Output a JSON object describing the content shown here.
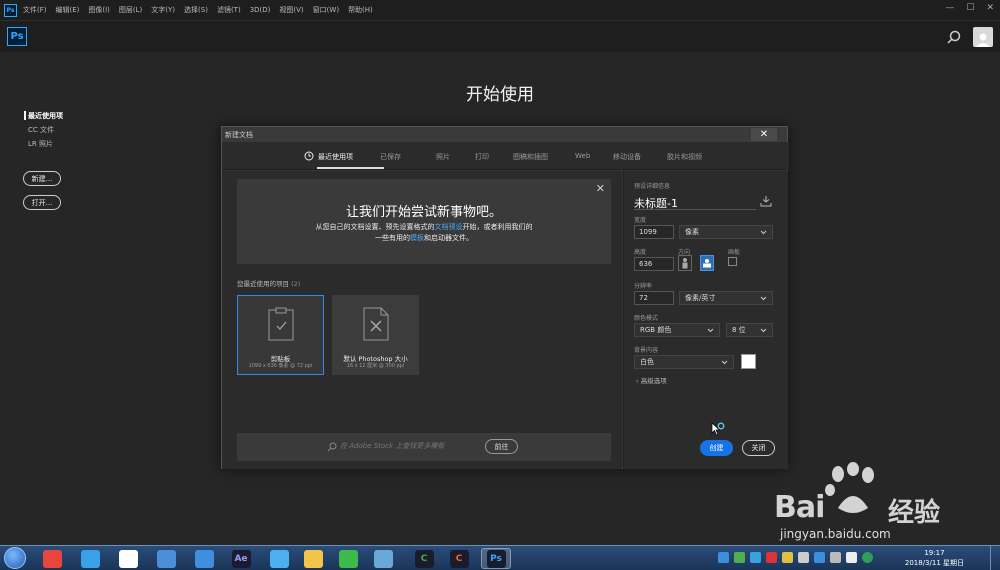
{
  "menubar": {
    "app_icon": "Ps",
    "items": [
      "文件(F)",
      "编辑(E)",
      "图像(I)",
      "图层(L)",
      "文字(Y)",
      "选择(S)",
      "滤镜(T)",
      "3D(D)",
      "视图(V)",
      "窗口(W)",
      "帮助(H)"
    ],
    "controls": [
      "—",
      "☐",
      "✕"
    ]
  },
  "appbar": {
    "logo": "Ps",
    "search_icon": "search-icon",
    "avatar_icon": "user-avatar-icon"
  },
  "start": {
    "title": "开始使用",
    "nav": [
      "最近使用项",
      "CC 文件",
      "LR 照片"
    ],
    "new_button": "新建...",
    "open_button": "打开..."
  },
  "dialog": {
    "title": "新建文档",
    "close": "✕",
    "tabs": [
      "最近使用项",
      "已保存",
      "照片",
      "打印",
      "图稿和插图",
      "Web",
      "移动设备",
      "胶片和视频"
    ],
    "active_tab": 0,
    "promo": {
      "title": "让我们开始尝试新事物吧。",
      "line1_a": "从您自己的文档设置、预先设置格式的",
      "line1_link": "文档预设",
      "line1_b": "开始，或者利用我们的",
      "line2_a": "一些有用的",
      "line2_link": "模板",
      "line2_b": "和启动器文件。",
      "close": "✕"
    },
    "recent_label": "您最近使用的项目",
    "recent_count": "(2)",
    "cards": [
      {
        "name": "剪贴板",
        "meta": "1099 x 636 像素 @ 72 ppi",
        "icon": "clipboard-doc-icon"
      },
      {
        "name": "默认 Photoshop 大小",
        "meta": "16 x 12 厘米 @ 300 ppi",
        "icon": "blank-doc-icon"
      }
    ],
    "stock_search_placeholder": "在 Adobe Stock 上查找更多模板",
    "stock_go_button": "前往",
    "details": {
      "section_label": "预设详细信息",
      "name": "未标题-1",
      "width_label": "宽度",
      "width_value": "1099",
      "width_unit": "像素",
      "height_label": "高度",
      "height_value": "636",
      "orientation_label": "方向",
      "artboard_label": "画板",
      "resolution_label": "分辨率",
      "resolution_value": "72",
      "resolution_unit": "像素/英寸",
      "color_mode_label": "颜色模式",
      "color_mode_value": "RGB 颜色",
      "bit_depth_value": "8 位",
      "background_label": "背景内容",
      "background_value": "白色",
      "background_swatch": "#ffffff",
      "advanced_label": "高级选项",
      "create_button": "创建",
      "close_button": "关闭"
    }
  },
  "watermark": {
    "brand": "Bai",
    "cn": "经验",
    "url": "jingyan.baidu.com"
  },
  "taskbar": {
    "apps": [
      {
        "label": "",
        "icon": "chrome-icon",
        "color": "#e8453c"
      },
      {
        "label": "",
        "icon": "ie-icon",
        "color": "#3aa0e8"
      },
      {
        "label": "",
        "icon": "qq-penguin-icon",
        "color": "#ffffff"
      },
      {
        "label": "",
        "icon": "calculator-icon",
        "color": "#4a8fd8"
      },
      {
        "label": "",
        "icon": "pen-icon",
        "color": "#3f8ee0"
      },
      {
        "label": "Ae",
        "icon": "after-effects-icon",
        "color": "#9999ff"
      },
      {
        "label": "",
        "icon": "bird-icon",
        "color": "#4ab0f0"
      },
      {
        "label": "",
        "icon": "folder-icon",
        "color": "#f3c44a"
      },
      {
        "label": "",
        "icon": "360-browser-icon",
        "color": "#3dbb4a"
      },
      {
        "label": "",
        "icon": "network-icon",
        "color": "#6aa8d8"
      },
      {
        "label": "C",
        "icon": "camtasia-green-icon",
        "color": "#3cb44a"
      },
      {
        "label": "C",
        "icon": "camtasia-orange-icon",
        "color": "#ee6a2a"
      },
      {
        "label": "Ps",
        "icon": "photoshop-icon",
        "color": "#31a8ff"
      }
    ],
    "time": "19:17",
    "date": "2018/3/11 星期日"
  }
}
